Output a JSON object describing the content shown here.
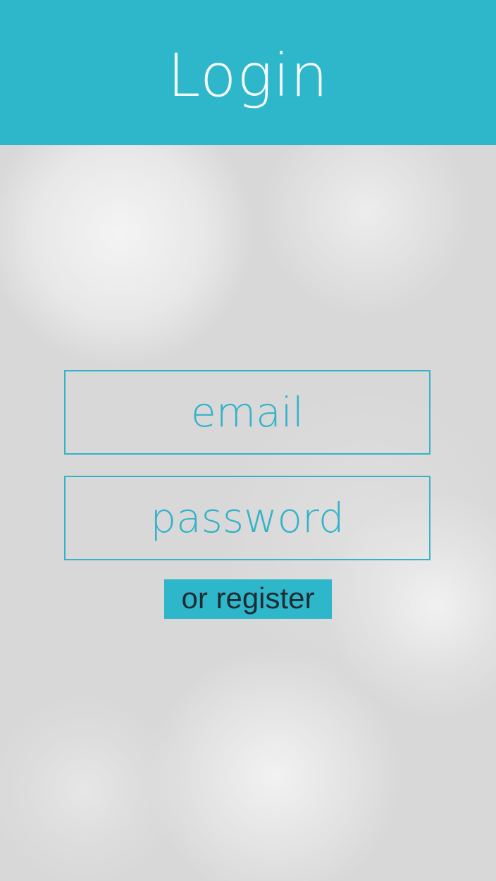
{
  "header": {
    "title": "Login",
    "background_color": "#2eb6ca",
    "title_color": "#f4fbff"
  },
  "form": {
    "email": {
      "placeholder": "email",
      "value": ""
    },
    "password": {
      "placeholder": "password",
      "value": ""
    },
    "register_label": "or register"
  },
  "colors": {
    "accent": "#33b2c9",
    "background": "#d9d9d9",
    "button_text": "#1f2c33"
  }
}
